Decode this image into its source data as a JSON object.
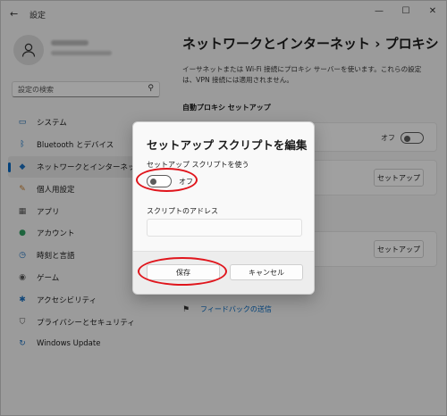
{
  "window": {
    "title": "設定",
    "back_glyph": "←",
    "controls": {
      "minimize": "—",
      "maximize": "☐",
      "close": "✕"
    }
  },
  "sidebar": {
    "search_placeholder": "設定の検索",
    "items": [
      {
        "label": "システム",
        "icon": "monitor-icon",
        "color": "#0a5ea8"
      },
      {
        "label": "Bluetooth とデバイス",
        "icon": "bluetooth-icon",
        "color": "#0067c0"
      },
      {
        "label": "ネットワークとインターネット",
        "icon": "wifi-icon",
        "color": "#1d6fbd",
        "active": true
      },
      {
        "label": "個人用設定",
        "icon": "brush-icon",
        "color": "#c77d2e"
      },
      {
        "label": "アプリ",
        "icon": "apps-icon",
        "color": "#555555"
      },
      {
        "label": "アカウント",
        "icon": "person-icon",
        "color": "#2f9e62"
      },
      {
        "label": "時刻と言語",
        "icon": "globe-clock-icon",
        "color": "#1d6fbd"
      },
      {
        "label": "ゲーム",
        "icon": "gamepad-icon",
        "color": "#555555"
      },
      {
        "label": "アクセシビリティ",
        "icon": "accessibility-icon",
        "color": "#1d6fbd"
      },
      {
        "label": "プライバシーとセキュリティ",
        "icon": "shield-icon",
        "color": "#555555"
      },
      {
        "label": "Windows Update",
        "icon": "update-icon",
        "color": "#1d6fbd"
      }
    ]
  },
  "main": {
    "title": "ネットワークとインターネット  ›  プロキシ",
    "description": "イーサネットまたは Wi-Fi 接続にプロキシ サーバーを使います。これらの設定は、VPN 接続には適用されません。",
    "section_auto": "自動プロキシ セットアップ",
    "card_toggle_state": "オフ",
    "card_button_1": "セットアップ",
    "card_button_2": "セットアップ",
    "feedback_label": "フィードバックの送信"
  },
  "dialog": {
    "title": "セットアップ スクリプトを編集",
    "use_script_label": "セットアップ スクリプトを使う",
    "toggle_state": "オフ",
    "address_label": "スクリプトのアドレス",
    "address_value": "",
    "save_label": "保存",
    "cancel_label": "キャンセル"
  },
  "colors": {
    "accent": "#0067c0",
    "annotation": "#e0151c"
  }
}
